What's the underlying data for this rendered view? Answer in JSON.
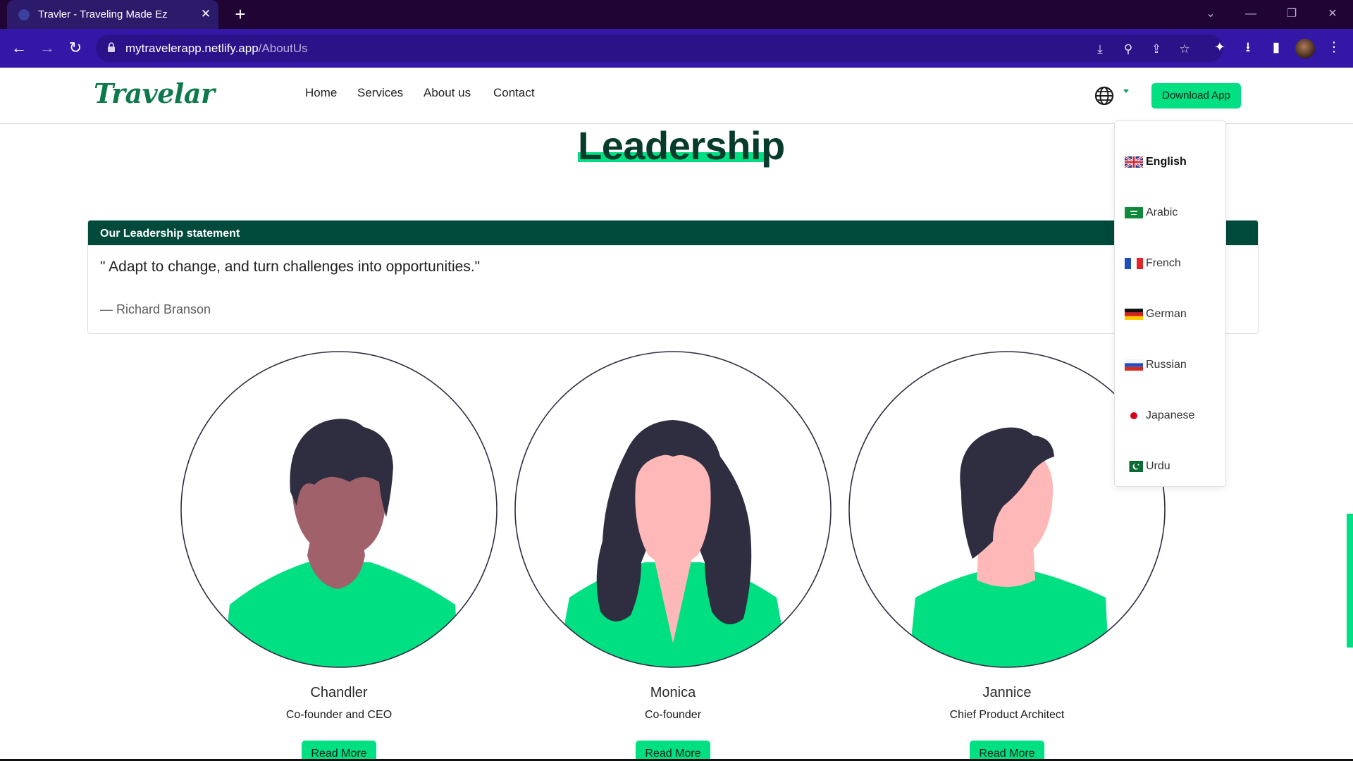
{
  "browser": {
    "tab_title": "Travler - Traveling Made Ez",
    "url_host": "mytravelerapp.netlify.app",
    "url_path": "/AboutUs",
    "new_tab_symbol": "+",
    "close_symbol": "✕"
  },
  "site": {
    "logo": "Travelar",
    "nav": [
      "Home",
      "Services",
      "About us",
      "Contact"
    ],
    "download_button": "Download App",
    "accent_color": "#00df82",
    "dark_green": "#004a3b"
  },
  "section": {
    "heading": "Leadership"
  },
  "statement": {
    "header": "Our Leadership statement",
    "quote": "\" Adapt to change, and turn challenges into opportunities.\"",
    "author": "— Richard Branson"
  },
  "team": [
    {
      "name": "Chandler",
      "role": "Co-founder and CEO",
      "button": "Read More"
    },
    {
      "name": "Monica",
      "role": "Co-founder",
      "button": "Read More"
    },
    {
      "name": "Jannice",
      "role": "Chief Product Architect",
      "button": "Read More"
    }
  ],
  "languages": [
    {
      "label": "English",
      "flag": "uk-flag-icon",
      "selected": true
    },
    {
      "label": "Arabic",
      "flag": "saudi-flag-icon",
      "selected": false
    },
    {
      "label": "French",
      "flag": "france-flag-icon",
      "selected": false
    },
    {
      "label": "German",
      "flag": "germany-flag-icon",
      "selected": false
    },
    {
      "label": "Russian",
      "flag": "russia-flag-icon",
      "selected": false
    },
    {
      "label": "Japanese",
      "flag": "japan-flag-icon",
      "selected": false
    },
    {
      "label": "Urdu",
      "flag": "pakistan-flag-icon",
      "selected": false
    }
  ]
}
